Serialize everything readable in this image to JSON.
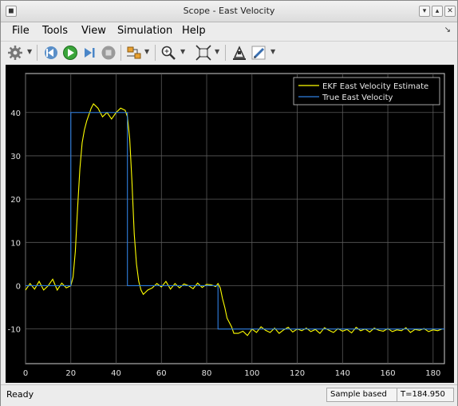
{
  "window": {
    "title": "Scope - East Velocity"
  },
  "menu": [
    "File",
    "Tools",
    "View",
    "Simulation",
    "Help"
  ],
  "toolbar": {
    "icons": [
      "gear-icon",
      "step-back-icon",
      "run-icon",
      "step-forward-icon",
      "stop-icon",
      "signal-select-icon",
      "zoom-icon",
      "fit-to-view-icon",
      "highlight-icon",
      "edit-style-icon"
    ]
  },
  "status": {
    "ready": "Ready",
    "mode": "Sample based",
    "time": "T=184.950"
  },
  "chart_data": {
    "type": "line",
    "title": "",
    "xlabel": "",
    "ylabel": "",
    "xlim": [
      0,
      185
    ],
    "ylim": [
      -18,
      49
    ],
    "xticks": [
      0,
      20,
      40,
      60,
      80,
      100,
      120,
      140,
      160,
      180
    ],
    "yticks": [
      -10,
      0,
      10,
      20,
      30,
      40
    ],
    "grid": true,
    "legend": "top-right",
    "background": "#000000",
    "series": [
      {
        "name": "EKF East Velocity Estimate",
        "color": "#ffff00",
        "x": [
          0,
          2,
          4,
          6,
          8,
          10,
          12,
          14,
          16,
          18,
          20,
          21,
          22,
          23,
          24,
          25,
          26,
          27,
          28,
          29,
          30,
          32,
          34,
          36,
          38,
          40,
          42,
          44,
          45,
          46,
          47,
          48,
          49,
          50,
          51,
          52,
          53,
          54,
          56,
          58,
          60,
          62,
          64,
          66,
          68,
          70,
          72,
          74,
          76,
          78,
          80,
          82,
          84,
          85,
          86,
          87,
          88,
          89,
          90,
          91,
          92,
          94,
          96,
          98,
          100,
          102,
          104,
          106,
          108,
          110,
          112,
          114,
          116,
          118,
          120,
          122,
          124,
          126,
          128,
          130,
          132,
          134,
          136,
          138,
          140,
          142,
          144,
          146,
          148,
          150,
          152,
          154,
          156,
          158,
          160,
          162,
          164,
          166,
          168,
          170,
          172,
          174,
          176,
          178,
          180,
          182,
          184
        ],
        "y": [
          -1,
          0.5,
          -0.8,
          1,
          -1,
          0,
          1.5,
          -1,
          0.6,
          -0.5,
          0,
          2,
          8,
          18,
          27,
          33,
          36,
          38,
          39.5,
          41,
          42,
          41,
          39,
          40,
          38.5,
          40,
          41,
          40.5,
          39,
          34,
          24,
          12,
          5,
          1,
          -1,
          -2,
          -1.5,
          -1,
          -0.5,
          0.5,
          -0.3,
          1,
          -0.8,
          0.5,
          -0.5,
          0.4,
          0,
          -0.7,
          0.6,
          -0.4,
          0.3,
          0.2,
          -0.2,
          0.5,
          -0.5,
          -3,
          -5,
          -7.5,
          -8.5,
          -9.5,
          -11,
          -11,
          -10.5,
          -11.5,
          -10,
          -10.8,
          -9.5,
          -10.3,
          -10.8,
          -9.8,
          -11,
          -10.2,
          -9.6,
          -10.7,
          -10,
          -10.4,
          -9.8,
          -10.6,
          -10.1,
          -11,
          -9.7,
          -10.3,
          -10.8,
          -9.9,
          -10.5,
          -10.1,
          -10.9,
          -9.6,
          -10.4,
          -10,
          -10.7,
          -9.8,
          -10.3,
          -10.5,
          -9.9,
          -10.6,
          -10.2,
          -10.4,
          -9.7,
          -10.8,
          -10.1,
          -10.3,
          -9.9,
          -10.6,
          -10.2,
          -10.4,
          -10
        ]
      },
      {
        "name": "True East Velocity",
        "color": "#2f7fe0",
        "step": true,
        "x": [
          0,
          20,
          45,
          85,
          185
        ],
        "y": [
          0,
          40,
          0,
          -10,
          -10
        ]
      }
    ]
  }
}
